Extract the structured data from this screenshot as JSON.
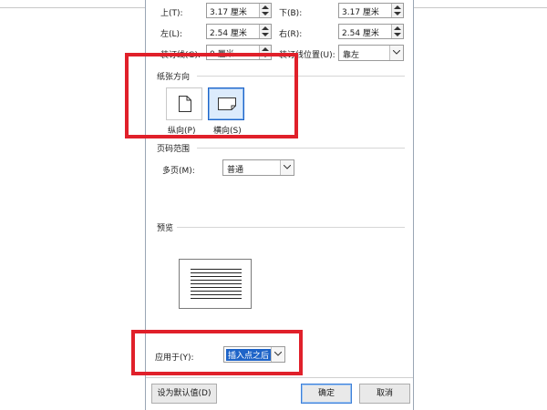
{
  "margins": {
    "top": {
      "label": "上(T):",
      "value": "3.17 厘米"
    },
    "bottom": {
      "label": "下(B):",
      "value": "3.17 厘米"
    },
    "left": {
      "label": "左(L):",
      "value": "2.54 厘米"
    },
    "right": {
      "label": "右(R):",
      "value": "2.54 厘米"
    },
    "gutter": {
      "label": "装订线(G):",
      "value": "0 厘米"
    },
    "gutter_position": {
      "label": "装订线位置(U):",
      "value": "靠左"
    }
  },
  "orientation": {
    "title": "纸张方向",
    "portrait_label": "纵向(P)",
    "landscape_label": "横向(S)",
    "selected": "landscape"
  },
  "pages": {
    "title": "页码范围",
    "multiple_label": "多页(M):",
    "multiple_value": "普通"
  },
  "preview": {
    "title": "预览"
  },
  "apply": {
    "label": "应用于(Y):",
    "value": "插入点之后"
  },
  "buttons": {
    "set_default": "设为默认值(D)",
    "ok": "确定",
    "cancel": "取消"
  },
  "colors": {
    "highlight_red": "#e0202a",
    "selection_blue": "#1e64c8"
  }
}
